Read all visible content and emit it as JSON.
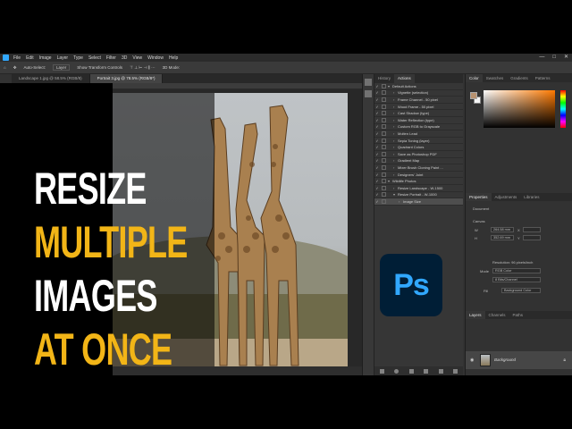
{
  "app": {
    "menu": [
      "File",
      "Edit",
      "Image",
      "Layer",
      "Type",
      "Select",
      "Filter",
      "3D",
      "View",
      "Window",
      "Help"
    ],
    "window_controls": [
      "—",
      "□",
      "✕"
    ]
  },
  "options_bar": {
    "auto_select": "Auto-Select:",
    "layer_select": "Layer",
    "show_transform": "Show Transform Controls",
    "mode_3d": "3D Mode:"
  },
  "tabs": [
    {
      "label": "Landscape 1.jpg @ 58.5% (RGB/8)",
      "active": false
    },
    {
      "label": "Portrait 3.jpg @ 78.5% (RGB/8*)",
      "active": true
    }
  ],
  "status_bar": "78.56%     264.58 mm x 352.69 mm (96 ppi)",
  "headline": {
    "line1": "RESIZE",
    "line2": "MULTIPLE",
    "line3": "IMAGES",
    "line4": "AT ONCE"
  },
  "actions_panel": {
    "tabs": [
      "History",
      "Actions"
    ],
    "rows": [
      {
        "label": "Default Actions",
        "check": "✓",
        "arrow": "▾",
        "selected": false
      },
      {
        "label": "Vignette (selection)",
        "check": "✓",
        "arrow": "›",
        "selected": false
      },
      {
        "label": "Frame Channel - 50 pixel",
        "check": "✓",
        "arrow": "›",
        "selected": false
      },
      {
        "label": "Wood Frame - 50 pixel",
        "check": "✓",
        "arrow": "›",
        "selected": false
      },
      {
        "label": "Cast Shadow (type)",
        "check": "✓",
        "arrow": "›",
        "selected": false
      },
      {
        "label": "Water Reflection (type)",
        "check": "✓",
        "arrow": "›",
        "selected": false
      },
      {
        "label": "Custom RGB to Grayscale",
        "check": "✓",
        "arrow": "›",
        "selected": false
      },
      {
        "label": "Molten Lead",
        "check": "✓",
        "arrow": "›",
        "selected": false
      },
      {
        "label": "Sepia Toning (layer)",
        "check": "✓",
        "arrow": "›",
        "selected": false
      },
      {
        "label": "Quadrant Colors",
        "check": "✓",
        "arrow": "›",
        "selected": false
      },
      {
        "label": "Save as Photoshop PDF",
        "check": "✓",
        "arrow": "›",
        "selected": false
      },
      {
        "label": "Gradient Map",
        "check": "✓",
        "arrow": "›",
        "selected": false
      },
      {
        "label": "Mixer Brush Cloning Paint ...",
        "check": "✓",
        "arrow": "›",
        "selected": false
      },
      {
        "label": "Designers' Joint",
        "check": "✓",
        "arrow": "›",
        "selected": false
      },
      {
        "label": "Wildlife Photos",
        "check": "✓",
        "arrow": "▾",
        "selected": false
      },
      {
        "label": "Resize Landscape - W-1500",
        "check": "✓",
        "arrow": "›",
        "selected": false
      },
      {
        "label": "Resize Portrait - W-1000",
        "check": "✓",
        "arrow": "▾",
        "selected": false
      },
      {
        "label": "Image Size",
        "check": "✓",
        "arrow": "›",
        "selected": true
      }
    ]
  },
  "right_panel": {
    "color_tabs": [
      "Color",
      "Swatches",
      "Gradients",
      "Patterns"
    ],
    "properties_tabs": [
      "Properties",
      "Adjustments",
      "Libraries"
    ],
    "document_label": "Document",
    "canvas_label": "Canvas",
    "width_label": "W",
    "width_value": "264.58 mm",
    "height_label": "H",
    "height_value": "352.69 mm",
    "x_label": "X",
    "y_label": "Y",
    "resolution": "Resolution: 96 pixels/inch",
    "mode_label": "Mode",
    "mode_value": "RGB Color",
    "depth_value": "8 Bits/Channel",
    "fill_label": "Fill",
    "fill_value": "Background Color",
    "layers_tabs": [
      "Layers",
      "Channels",
      "Paths"
    ],
    "layer_name": "Background"
  },
  "logo_text": "Ps",
  "colors": {
    "gold": "#f2b517",
    "ps_blue": "#31a8ff",
    "ps_navy": "#001e36"
  }
}
